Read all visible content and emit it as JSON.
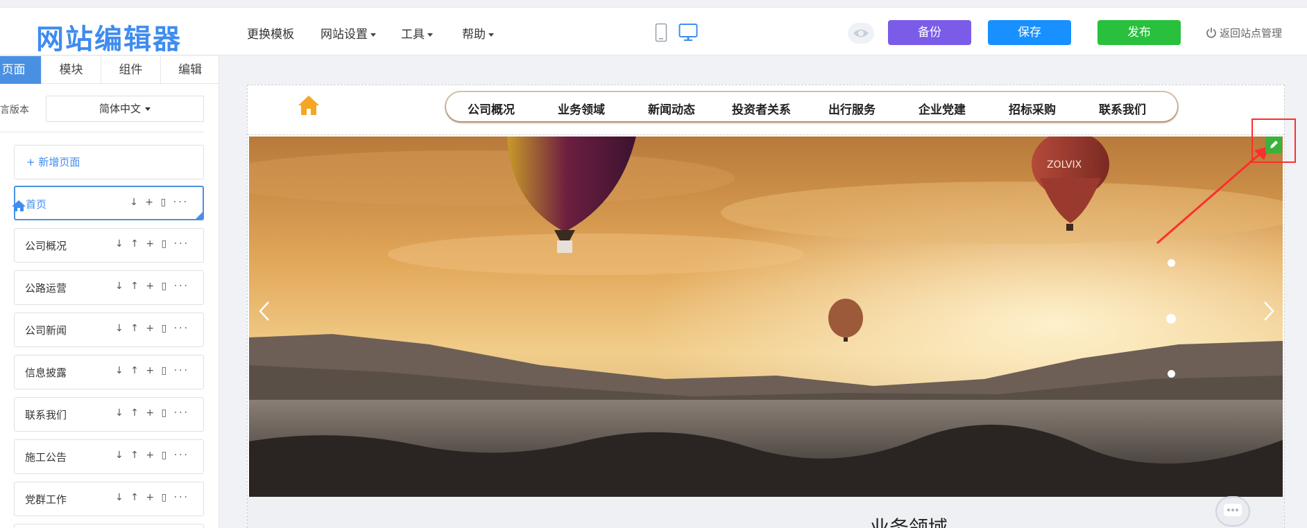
{
  "app": {
    "logo": "网站编辑器"
  },
  "topmenu": {
    "change_template": "更换模板",
    "site_settings": "网站设置",
    "tools": "工具",
    "help": "帮助"
  },
  "buttons": {
    "backup": "备份",
    "save": "保存",
    "publish": "发布",
    "back_to_site_admin": "返回站点管理"
  },
  "colors": {
    "backup": "#7b5ce8",
    "save": "#1890ff",
    "publish": "#28c03c",
    "accent": "#4a90e2",
    "highlight_box": "#ff2d2d",
    "edit_badge": "#3bb23b",
    "home_icon": "#f5a623"
  },
  "leftpanel": {
    "tabs": [
      "页面",
      "模块",
      "组件",
      "编辑"
    ],
    "active_tab": "页面",
    "language_label": "语言版本",
    "language_value": "简体中文",
    "add_page": "+ 新增页面",
    "pages": [
      {
        "name": "首页",
        "active": true,
        "actions": "↓ + ▯ ···"
      },
      {
        "name": "公司概况",
        "active": false,
        "actions": "↓ ↑ + ▯ ···"
      },
      {
        "name": "公路运营",
        "active": false,
        "actions": "↓ ↑ + ▯ ···"
      },
      {
        "name": "公司新闻",
        "active": false,
        "actions": "↓ ↑ + ▯ ···"
      },
      {
        "name": "信息披露",
        "active": false,
        "actions": "↓ ↑ + ▯ ···"
      },
      {
        "name": "联系我们",
        "active": false,
        "actions": "↓ ↑ + ▯ ···"
      },
      {
        "name": "施工公告",
        "active": false,
        "actions": "↓ ↑ + ▯ ···"
      },
      {
        "name": "党群工作",
        "active": false,
        "actions": "↓ ↑ + ▯ ···"
      }
    ]
  },
  "site": {
    "nav": [
      "公司概况",
      "业务领域",
      "新闻动态",
      "投资者关系",
      "出行服务",
      "企业党建",
      "招标采购",
      "联系我们"
    ],
    "section_title": "业务领域",
    "balloon_brand": "ZOLVIX"
  },
  "icons": [
    "mobile-device-icon",
    "desktop-device-icon",
    "eye-icon",
    "power-icon",
    "home-icon",
    "pencil-icon",
    "chevron-left-icon",
    "chevron-right-icon",
    "chat-icon"
  ]
}
